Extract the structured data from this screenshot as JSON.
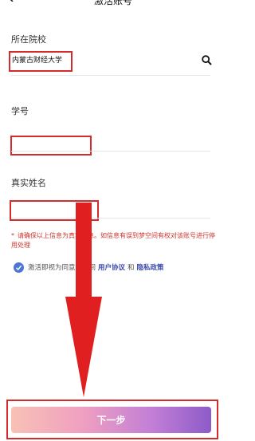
{
  "header": {
    "title": "激活账号",
    "back_icon": "chevron-left-icon"
  },
  "form": {
    "school": {
      "label": "所在院校",
      "value": "内蒙古财经大学",
      "icon": "search-icon"
    },
    "student_id": {
      "label": "学号",
      "value": ""
    },
    "real_name": {
      "label": "真实姓名",
      "value": ""
    }
  },
  "notice": {
    "star": "*",
    "text": "请确保以上信息为真实信息。如信息有误到梦空间有权对该账号进行停用处理"
  },
  "agreement": {
    "prefix": "激活即视为同意梦空间",
    "user_agreement": "用户协议",
    "and": "和",
    "privacy_policy": "隐私政策",
    "check_color": "#4a76d6"
  },
  "next_button": {
    "label": "下一步"
  },
  "colors": {
    "highlight": "#d42c2c",
    "arrow": "#e02020",
    "link": "#3b4bb0"
  }
}
